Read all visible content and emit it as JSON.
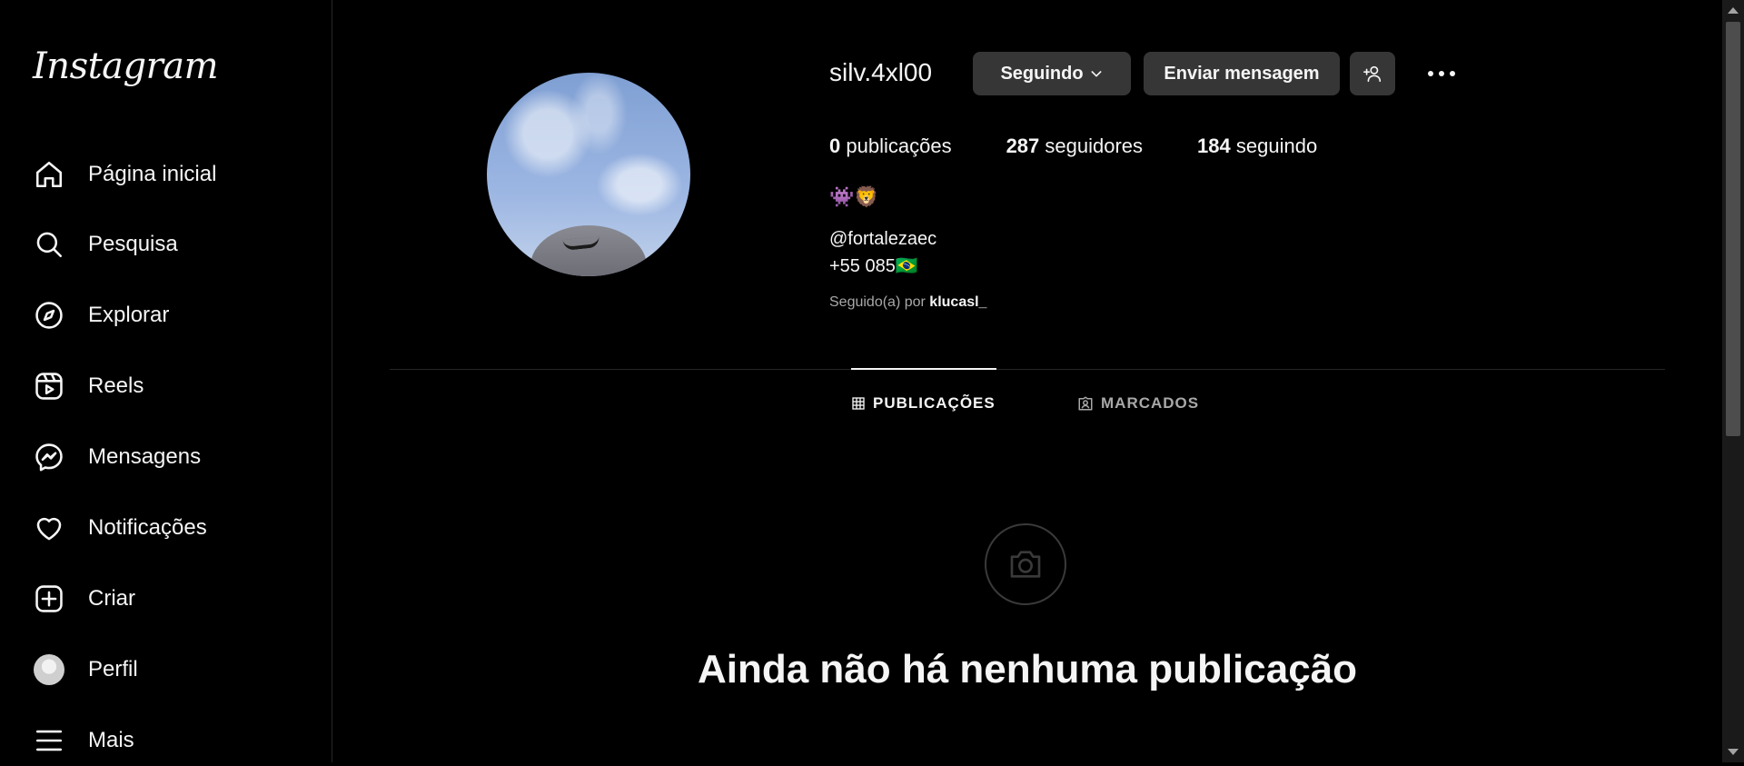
{
  "sidebar": {
    "logo": "Instagram",
    "items": [
      {
        "label": "Página inicial",
        "icon": "home-icon"
      },
      {
        "label": "Pesquisa",
        "icon": "search-icon"
      },
      {
        "label": "Explorar",
        "icon": "compass-icon"
      },
      {
        "label": "Reels",
        "icon": "reels-icon"
      },
      {
        "label": "Mensagens",
        "icon": "messenger-icon"
      },
      {
        "label": "Notificações",
        "icon": "heart-icon"
      },
      {
        "label": "Criar",
        "icon": "plus-square-icon"
      },
      {
        "label": "Perfil",
        "icon": "avatar"
      },
      {
        "label": "Mais",
        "icon": "menu-icon"
      }
    ]
  },
  "profile": {
    "username": "silv.4xl00",
    "follow_button": "Seguindo",
    "message_button": "Enviar mensagem",
    "stats": {
      "posts_count": "0",
      "posts_label": "publicações",
      "followers_count": "287",
      "followers_label": "seguidores",
      "following_count": "184",
      "following_label": "seguindo"
    },
    "emojis": "👾🦁",
    "bio_line1": "@fortalezaec",
    "bio_line2": "+55 085🇧🇷",
    "followed_by_prefix": "Seguido(a) por",
    "followed_by_user": "klucasl_"
  },
  "tabs": [
    {
      "label": "PUBLICAÇÕES",
      "icon": "grid-icon",
      "active": true
    },
    {
      "label": "MARCADOS",
      "icon": "tagged-icon",
      "active": false
    }
  ],
  "empty_state": {
    "icon": "camera-icon",
    "title": "Ainda não há nenhuma publicação"
  },
  "colors": {
    "background": "#000000",
    "button": "#363636",
    "text": "#f5f5f5",
    "muted": "#a8a8a8"
  }
}
